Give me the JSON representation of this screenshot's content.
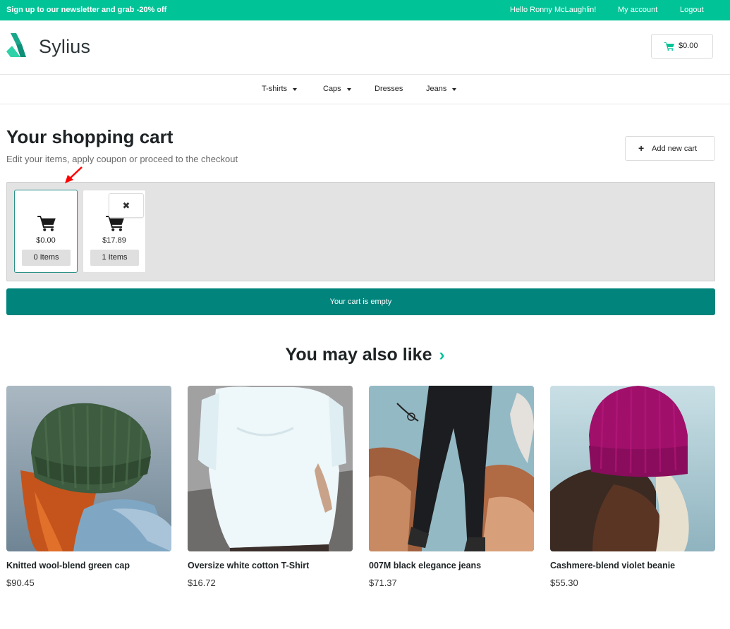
{
  "topbar": {
    "promo": "Sign up to our newsletter and grab -20% off",
    "greeting": "Hello Ronny McLaughlin!",
    "my_account": "My account",
    "logout": "Logout"
  },
  "header": {
    "logo_text": "Sylius",
    "cart_total": "$0.00",
    "cart_icon": "shopping-cart-icon"
  },
  "nav": [
    {
      "label": "T-shirts",
      "has_dropdown": true
    },
    {
      "label": "Caps",
      "has_dropdown": true
    },
    {
      "label": "Dresses",
      "has_dropdown": false
    },
    {
      "label": "Jeans",
      "has_dropdown": true
    }
  ],
  "page": {
    "title": "Your shopping cart",
    "subtitle": "Edit your items, apply coupon or proceed to the checkout",
    "add_new_cart": "Add new cart",
    "empty_message": "Your cart is empty"
  },
  "carts": [
    {
      "total": "$0.00",
      "items": "0 Items",
      "active": true
    },
    {
      "total": "$17.89",
      "items": "1 Items",
      "active": false,
      "remove_label": "✖"
    }
  ],
  "recommendations": {
    "title": "You may also like",
    "arrow": "›",
    "products": [
      {
        "name": "Knitted wool-blend green cap",
        "price": "$90.45"
      },
      {
        "name": "Oversize white cotton T-Shirt",
        "price": "$16.72"
      },
      {
        "name": "007M black elegance jeans",
        "price": "$71.37"
      },
      {
        "name": "Cashmere-blend violet beanie",
        "price": "$55.30"
      }
    ]
  },
  "colors": {
    "brand": "#00c497",
    "cart_empty_bar": "#00847c",
    "annotation_arrow": "#ff0000"
  }
}
